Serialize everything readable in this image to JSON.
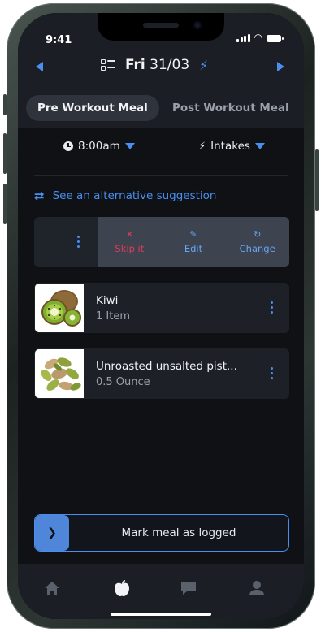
{
  "status_bar": {
    "time": "9:41"
  },
  "header": {
    "day": "Fri",
    "date": "31/03"
  },
  "tabs": [
    {
      "label": "Pre Workout Meal",
      "active": true
    },
    {
      "label": "Post Workout Meal",
      "active": false
    }
  ],
  "filters": {
    "time": "8:00am",
    "intakes": "Intakes"
  },
  "alternative_link": "See an alternative suggestion",
  "row_actions": {
    "skip": "Skip it",
    "edit": "Edit",
    "change": "Change"
  },
  "foods": [
    {
      "name": "Kiwi",
      "quantity": "1 Item",
      "image": "kiwi"
    },
    {
      "name": "Unroasted unsalted pist...",
      "quantity": "0.5 Ounce",
      "image": "pistachios"
    }
  ],
  "mark_logged": "Mark meal as logged",
  "bottom_nav": [
    {
      "icon": "home-icon"
    },
    {
      "icon": "apple-icon",
      "active": true
    },
    {
      "icon": "chat-icon"
    },
    {
      "icon": "profile-icon"
    }
  ],
  "colors": {
    "accent": "#4a8ef0",
    "danger": "#e23a5a",
    "background": "#0f1115",
    "surface": "#1b1e24"
  }
}
